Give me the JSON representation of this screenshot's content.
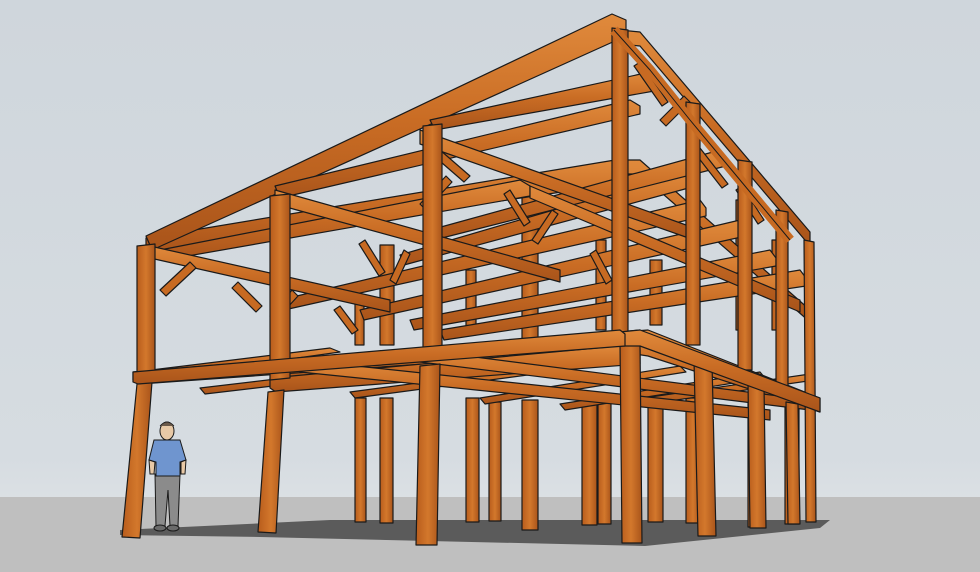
{
  "scene": {
    "subject": "timber-frame-structure",
    "colors": {
      "sky": "#d3d9de",
      "ground": "#bfbfbf",
      "shadow": "#5b5b5b",
      "timber": "#c76a22",
      "timber_side": "#a95418",
      "timber_top": "#e08a3c",
      "outline": "#1a1a1a",
      "shirt": "#6f95cf",
      "pants": "#8b8b8b",
      "skin": "#e8c9a6"
    },
    "elements": {
      "ground": "ground-plane",
      "shadow": "floor-shadow",
      "figure": "scale-person"
    }
  }
}
